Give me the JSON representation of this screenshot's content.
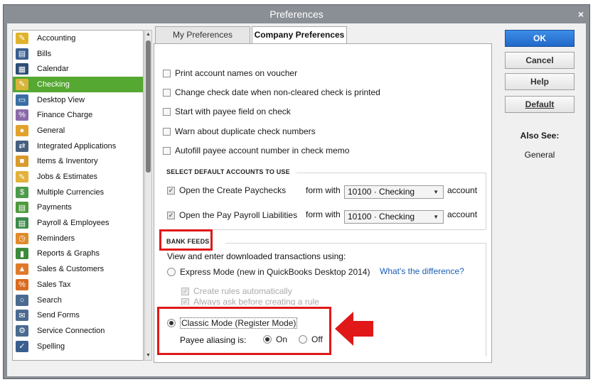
{
  "window": {
    "title": "Preferences",
    "close_label": "×"
  },
  "sidebar": {
    "items": [
      {
        "label": "Accounting",
        "icon": "accounting-icon",
        "color": "#e1b32c",
        "glyph": "✎"
      },
      {
        "label": "Bills",
        "icon": "bills-icon",
        "color": "#3a5f8f",
        "glyph": "▤"
      },
      {
        "label": "Calendar",
        "icon": "calendar-icon",
        "color": "#2d4d75",
        "glyph": "▦"
      },
      {
        "label": "Checking",
        "icon": "checking-icon",
        "color": "#d8b43a",
        "glyph": "✎"
      },
      {
        "label": "Desktop View",
        "icon": "desktop-view-icon",
        "color": "#3a6ea5",
        "glyph": "▭"
      },
      {
        "label": "Finance Charge",
        "icon": "finance-charge-icon",
        "color": "#8a6aa8",
        "glyph": "%"
      },
      {
        "label": "General",
        "icon": "general-icon",
        "color": "#e2a12c",
        "glyph": "●"
      },
      {
        "label": "Integrated Applications",
        "icon": "integrated-apps-icon",
        "color": "#46607e",
        "glyph": "⇄"
      },
      {
        "label": "Items & Inventory",
        "icon": "items-inventory-icon",
        "color": "#d99a2b",
        "glyph": "■"
      },
      {
        "label": "Jobs & Estimates",
        "icon": "jobs-estimates-icon",
        "color": "#e2b23a",
        "glyph": "✎"
      },
      {
        "label": "Multiple Currencies",
        "icon": "multiple-currencies-icon",
        "color": "#4c9a4a",
        "glyph": "$"
      },
      {
        "label": "Payments",
        "icon": "payments-icon",
        "color": "#4f9a3c",
        "glyph": "▤"
      },
      {
        "label": "Payroll & Employees",
        "icon": "payroll-employees-icon",
        "color": "#3d8a4a",
        "glyph": "▤"
      },
      {
        "label": "Reminders",
        "icon": "reminders-icon",
        "color": "#e08a2a",
        "glyph": "◷"
      },
      {
        "label": "Reports & Graphs",
        "icon": "reports-graphs-icon",
        "color": "#3c8a3c",
        "glyph": "▮"
      },
      {
        "label": "Sales & Customers",
        "icon": "sales-customers-icon",
        "color": "#e07a2a",
        "glyph": "▲"
      },
      {
        "label": "Sales Tax",
        "icon": "sales-tax-icon",
        "color": "#d96a1f",
        "glyph": "%"
      },
      {
        "label": "Search",
        "icon": "search-icon",
        "color": "#4a6a8f",
        "glyph": "○"
      },
      {
        "label": "Send Forms",
        "icon": "send-forms-icon",
        "color": "#4a6a8f",
        "glyph": "✉"
      },
      {
        "label": "Service Connection",
        "icon": "service-connection-icon",
        "color": "#4a6a8f",
        "glyph": "⚙"
      },
      {
        "label": "Spelling",
        "icon": "spelling-icon",
        "color": "#3a5f8f",
        "glyph": "✓"
      }
    ],
    "active_index": 3
  },
  "tabs": {
    "my_prefs": "My Preferences",
    "company_prefs": "Company Preferences"
  },
  "checkboxes": [
    {
      "label": "Print account names on voucher",
      "checked": false
    },
    {
      "label": "Change check date when non-cleared check is printed",
      "checked": false
    },
    {
      "label": "Start with payee field on check",
      "checked": false
    },
    {
      "label": "Warn about duplicate check numbers",
      "checked": false
    },
    {
      "label": "Autofill payee account number in check memo",
      "checked": false
    }
  ],
  "default_accounts": {
    "heading": "SELECT DEFAULT ACCOUNTS TO USE",
    "rows": [
      {
        "label": "Open the Create Paychecks",
        "form_with": "form with",
        "account": "10100 · Checking",
        "suffix": "account",
        "checked": true
      },
      {
        "label": "Open the Pay Payroll Liabilities",
        "form_with": "form with",
        "account": "10100 · Checking",
        "suffix": "account",
        "checked": true
      }
    ]
  },
  "bank_feeds": {
    "heading": "BANK FEEDS",
    "intro": "View and enter downloaded transactions using:",
    "express_label": "Express Mode (new in QuickBooks Desktop 2014)",
    "difference_link": "What's the difference?",
    "create_rules": "Create rules automatically",
    "always_ask": "Always ask before creating a rule",
    "classic_label": "Classic Mode (Register Mode)",
    "aliasing_label": "Payee aliasing is:",
    "on_label": "On",
    "off_label": "Off",
    "selected_mode": "classic",
    "aliasing": "on"
  },
  "buttons": {
    "ok": "OK",
    "cancel": "Cancel",
    "help": "Help",
    "default": "Default"
  },
  "also_see": {
    "title": "Also See:",
    "general": "General"
  },
  "colors": {
    "accent_green": "#55a831",
    "highlight_red": "#e01818",
    "ok_blue": "#2a78d8"
  }
}
